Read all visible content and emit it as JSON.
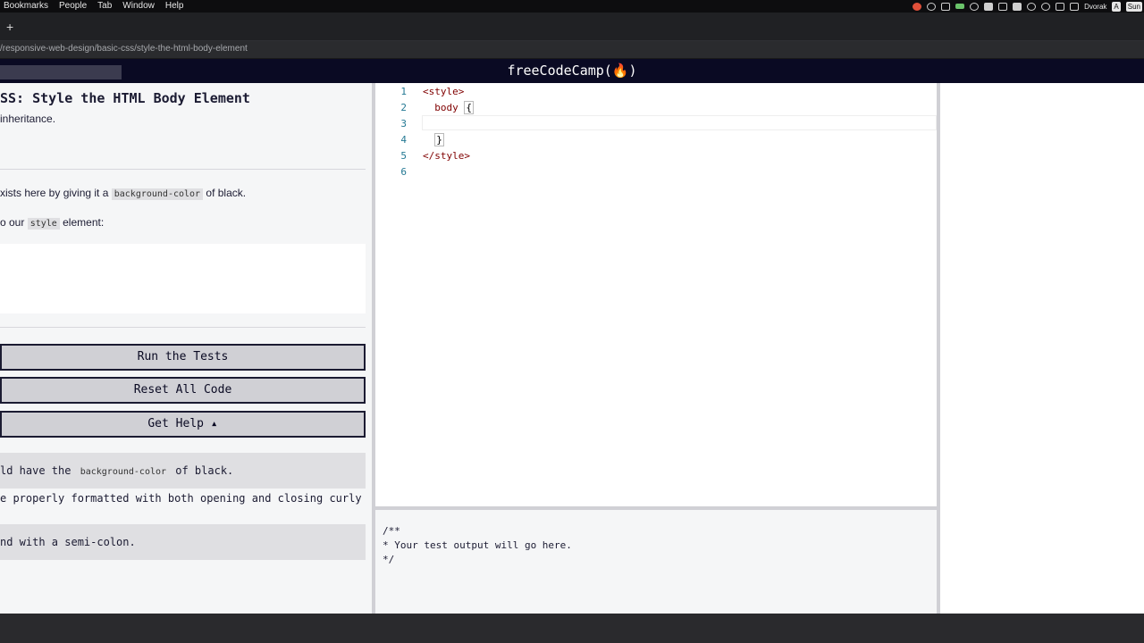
{
  "menubar": {
    "items": [
      "Bookmarks",
      "People",
      "Tab",
      "Window",
      "Help"
    ],
    "keyboard_layout": "Dvorak",
    "input_indicator": "A",
    "clock_partial": "Sun"
  },
  "browser": {
    "new_tab_label": "+",
    "url": "/responsive-web-design/basic-css/style-the-html-body-element"
  },
  "nav": {
    "logo": "freeCodeCamp(🔥)"
  },
  "challenge": {
    "title": "SS: Style the HTML Body Element",
    "subtitle": "inheritance.",
    "desc1_pre": "xists here by giving it a ",
    "desc1_code": "background-color",
    "desc1_post": " of black.",
    "desc2_pre": "o our ",
    "desc2_code": "style",
    "desc2_post": " element:"
  },
  "buttons": {
    "run": "Run the Tests",
    "reset": "Reset All Code",
    "help": "Get Help ▴"
  },
  "tests": {
    "t1_pre": "ld have the ",
    "t1_code": "background-color",
    "t1_post": " of black.",
    "t2": "e properly formatted with both opening and closing curly",
    "t3": "nd with a semi-colon."
  },
  "editor": {
    "lines": [
      "1",
      "2",
      "3",
      "4",
      "5",
      "6"
    ],
    "l1": "<style>",
    "l2_pre": "  body ",
    "l2_brace": "{",
    "l4_pre": "  ",
    "l4_brace": "}",
    "l5": "</style>"
  },
  "output": {
    "text": "/**\n* Your test output will go here.\n*/"
  }
}
